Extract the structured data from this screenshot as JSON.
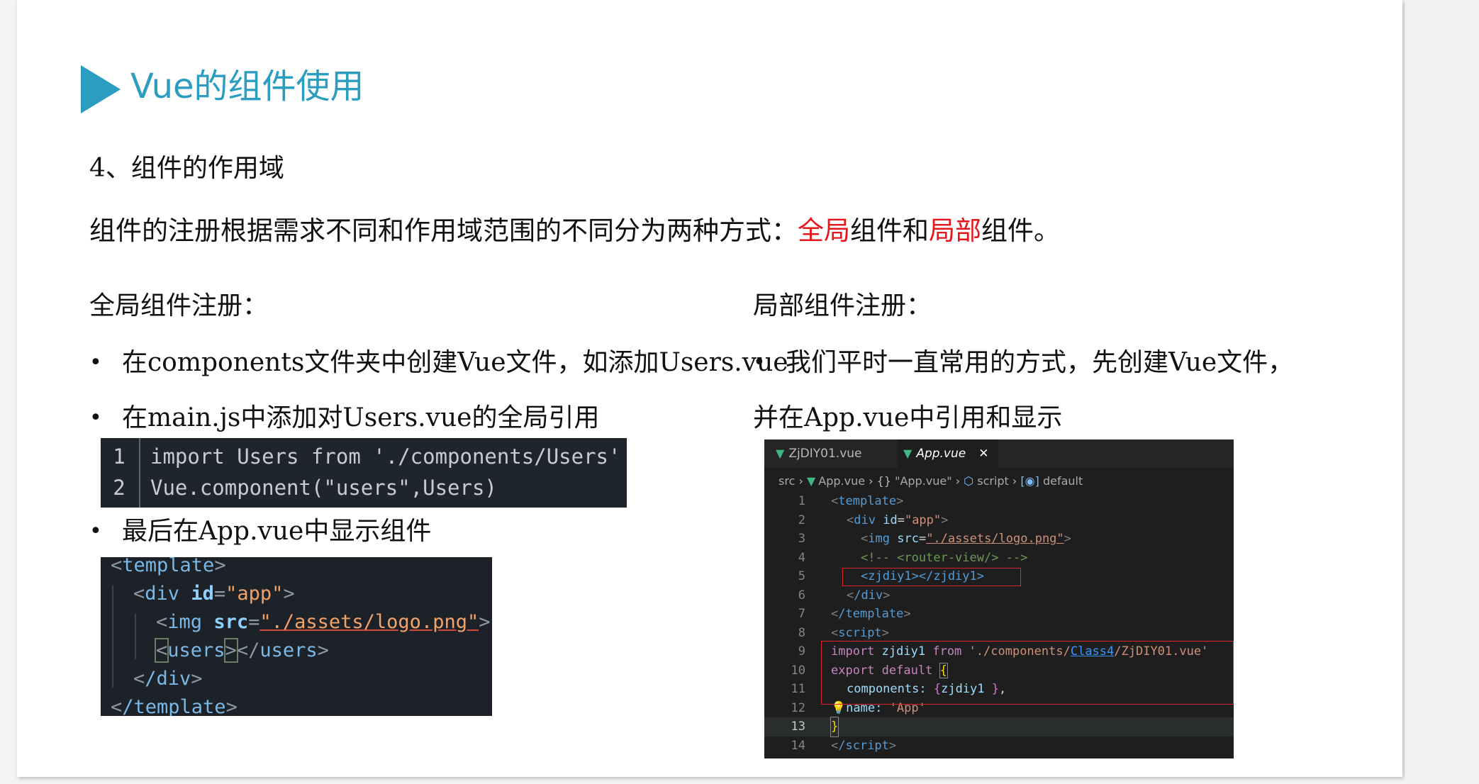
{
  "title": "Vue的组件使用",
  "section": "4、组件的作用域",
  "intro": {
    "before": "组件的注册根据需求不同和作用域范围的不同分为两种方式：",
    "global": "全局",
    "mid": "组件和",
    "local": "局部",
    "after": "组件。"
  },
  "left": {
    "heading": "全局组件注册：",
    "bullet_symbol": "•",
    "bullet1": "在components文件夹中创建Vue文件，如添加Users.vue",
    "bullet2": "在main.js中添加对Users.vue的全局引用",
    "bullet3": "最后在App.vue中显示组件"
  },
  "right": {
    "heading": "局部组件注册：",
    "bullet1": "我们平时一直常用的方式，先创建Vue文件，",
    "line2": "并在App.vue中引用和显示"
  },
  "code1": {
    "lines": [
      {
        "n": "1",
        "text": "import Users from './components/Users'"
      },
      {
        "n": "2",
        "text": "Vue.component(\"users\",Users)"
      }
    ]
  },
  "code2": {
    "l1_tag": "template",
    "l2_tag": "div",
    "l2_attr": "id",
    "l2_val": "\"app\"",
    "l3_tag": "img",
    "l3_attr": "src",
    "l3_val": "\"./assets/logo.png\"",
    "l4_tag": "users",
    "l5_tag": "/div",
    "l6_tag": "/template"
  },
  "vscode": {
    "tab1": "ZjDIY01.vue",
    "tab2": "App.vue",
    "tab_close": "✕",
    "crumbs": {
      "src": "src",
      "file": "App.vue",
      "braces": "{}",
      "scope": "\"App.vue\"",
      "script": "script",
      "default": "default"
    },
    "line_numbers": [
      "1",
      "2",
      "3",
      "4",
      "5",
      "6",
      "7",
      "8",
      "9",
      "10",
      "11",
      "12",
      "13",
      "14"
    ],
    "l1": "template",
    "l2_tag": "div",
    "l2_attr": "id",
    "l2_val": "\"app\"",
    "l3_tag": "img",
    "l3_attr": "src",
    "l3_val": "\"./assets/logo.png\"",
    "l4": "<!-- <router-view/> -->",
    "l5": "<zjdiy1></zjdiy1>",
    "l6": "/div",
    "l7": "/template",
    "l8": "script",
    "l9_kw1": "import",
    "l9_var": "zjdiy1",
    "l9_kw2": "from",
    "l9_str_a": "'./components/",
    "l9_link": "Class4",
    "l9_str_b": "/ZjDIY01.vue'",
    "l10_kw": "export",
    "l10_kw2": "default",
    "l11_key": "components:",
    "l11_val": "zjdiy1",
    "l12_key": "name:",
    "l12_val": "'App'",
    "l14": "/script"
  },
  "colors": {
    "accent": "#2a9dc0",
    "highlight_red": "#e8141b"
  }
}
